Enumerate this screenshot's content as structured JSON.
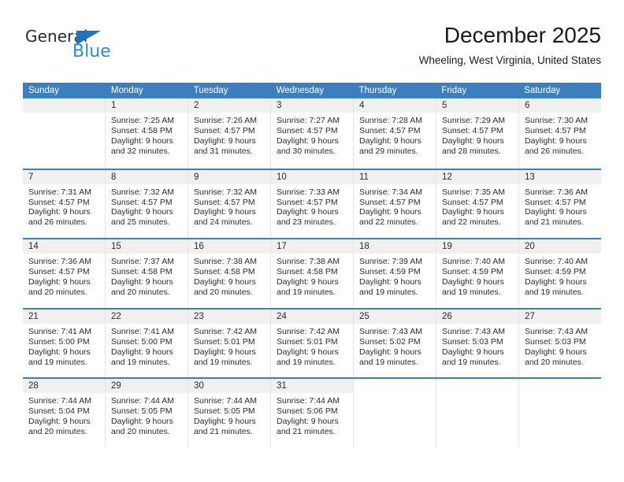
{
  "brand": {
    "name_top": "General",
    "name_bottom": "Blue",
    "triangle_color": "#1f72bd",
    "blue_color": "#2e8bd6"
  },
  "header": {
    "title": "December 2025",
    "subtitle": "Wheeling, West Virginia, United States",
    "accent_color": "#3d7ebf"
  },
  "weekdays": [
    "Sunday",
    "Monday",
    "Tuesday",
    "Wednesday",
    "Thursday",
    "Friday",
    "Saturday"
  ],
  "weeks": [
    [
      {
        "day": "",
        "sunrise": "",
        "sunset": "",
        "daylight1": "",
        "daylight2": "",
        "empty": true
      },
      {
        "day": "1",
        "sunrise": "Sunrise: 7:25 AM",
        "sunset": "Sunset: 4:58 PM",
        "daylight1": "Daylight: 9 hours",
        "daylight2": "and 32 minutes."
      },
      {
        "day": "2",
        "sunrise": "Sunrise: 7:26 AM",
        "sunset": "Sunset: 4:57 PM",
        "daylight1": "Daylight: 9 hours",
        "daylight2": "and 31 minutes."
      },
      {
        "day": "3",
        "sunrise": "Sunrise: 7:27 AM",
        "sunset": "Sunset: 4:57 PM",
        "daylight1": "Daylight: 9 hours",
        "daylight2": "and 30 minutes."
      },
      {
        "day": "4",
        "sunrise": "Sunrise: 7:28 AM",
        "sunset": "Sunset: 4:57 PM",
        "daylight1": "Daylight: 9 hours",
        "daylight2": "and 29 minutes."
      },
      {
        "day": "5",
        "sunrise": "Sunrise: 7:29 AM",
        "sunset": "Sunset: 4:57 PM",
        "daylight1": "Daylight: 9 hours",
        "daylight2": "and 28 minutes."
      },
      {
        "day": "6",
        "sunrise": "Sunrise: 7:30 AM",
        "sunset": "Sunset: 4:57 PM",
        "daylight1": "Daylight: 9 hours",
        "daylight2": "and 26 minutes."
      }
    ],
    [
      {
        "day": "7",
        "sunrise": "Sunrise: 7:31 AM",
        "sunset": "Sunset: 4:57 PM",
        "daylight1": "Daylight: 9 hours",
        "daylight2": "and 26 minutes."
      },
      {
        "day": "8",
        "sunrise": "Sunrise: 7:32 AM",
        "sunset": "Sunset: 4:57 PM",
        "daylight1": "Daylight: 9 hours",
        "daylight2": "and 25 minutes."
      },
      {
        "day": "9",
        "sunrise": "Sunrise: 7:32 AM",
        "sunset": "Sunset: 4:57 PM",
        "daylight1": "Daylight: 9 hours",
        "daylight2": "and 24 minutes."
      },
      {
        "day": "10",
        "sunrise": "Sunrise: 7:33 AM",
        "sunset": "Sunset: 4:57 PM",
        "daylight1": "Daylight: 9 hours",
        "daylight2": "and 23 minutes."
      },
      {
        "day": "11",
        "sunrise": "Sunrise: 7:34 AM",
        "sunset": "Sunset: 4:57 PM",
        "daylight1": "Daylight: 9 hours",
        "daylight2": "and 22 minutes."
      },
      {
        "day": "12",
        "sunrise": "Sunrise: 7:35 AM",
        "sunset": "Sunset: 4:57 PM",
        "daylight1": "Daylight: 9 hours",
        "daylight2": "and 22 minutes."
      },
      {
        "day": "13",
        "sunrise": "Sunrise: 7:36 AM",
        "sunset": "Sunset: 4:57 PM",
        "daylight1": "Daylight: 9 hours",
        "daylight2": "and 21 minutes."
      }
    ],
    [
      {
        "day": "14",
        "sunrise": "Sunrise: 7:36 AM",
        "sunset": "Sunset: 4:57 PM",
        "daylight1": "Daylight: 9 hours",
        "daylight2": "and 20 minutes."
      },
      {
        "day": "15",
        "sunrise": "Sunrise: 7:37 AM",
        "sunset": "Sunset: 4:58 PM",
        "daylight1": "Daylight: 9 hours",
        "daylight2": "and 20 minutes."
      },
      {
        "day": "16",
        "sunrise": "Sunrise: 7:38 AM",
        "sunset": "Sunset: 4:58 PM",
        "daylight1": "Daylight: 9 hours",
        "daylight2": "and 20 minutes."
      },
      {
        "day": "17",
        "sunrise": "Sunrise: 7:38 AM",
        "sunset": "Sunset: 4:58 PM",
        "daylight1": "Daylight: 9 hours",
        "daylight2": "and 19 minutes."
      },
      {
        "day": "18",
        "sunrise": "Sunrise: 7:39 AM",
        "sunset": "Sunset: 4:59 PM",
        "daylight1": "Daylight: 9 hours",
        "daylight2": "and 19 minutes."
      },
      {
        "day": "19",
        "sunrise": "Sunrise: 7:40 AM",
        "sunset": "Sunset: 4:59 PM",
        "daylight1": "Daylight: 9 hours",
        "daylight2": "and 19 minutes."
      },
      {
        "day": "20",
        "sunrise": "Sunrise: 7:40 AM",
        "sunset": "Sunset: 4:59 PM",
        "daylight1": "Daylight: 9 hours",
        "daylight2": "and 19 minutes."
      }
    ],
    [
      {
        "day": "21",
        "sunrise": "Sunrise: 7:41 AM",
        "sunset": "Sunset: 5:00 PM",
        "daylight1": "Daylight: 9 hours",
        "daylight2": "and 19 minutes."
      },
      {
        "day": "22",
        "sunrise": "Sunrise: 7:41 AM",
        "sunset": "Sunset: 5:00 PM",
        "daylight1": "Daylight: 9 hours",
        "daylight2": "and 19 minutes."
      },
      {
        "day": "23",
        "sunrise": "Sunrise: 7:42 AM",
        "sunset": "Sunset: 5:01 PM",
        "daylight1": "Daylight: 9 hours",
        "daylight2": "and 19 minutes."
      },
      {
        "day": "24",
        "sunrise": "Sunrise: 7:42 AM",
        "sunset": "Sunset: 5:01 PM",
        "daylight1": "Daylight: 9 hours",
        "daylight2": "and 19 minutes."
      },
      {
        "day": "25",
        "sunrise": "Sunrise: 7:43 AM",
        "sunset": "Sunset: 5:02 PM",
        "daylight1": "Daylight: 9 hours",
        "daylight2": "and 19 minutes."
      },
      {
        "day": "26",
        "sunrise": "Sunrise: 7:43 AM",
        "sunset": "Sunset: 5:03 PM",
        "daylight1": "Daylight: 9 hours",
        "daylight2": "and 19 minutes."
      },
      {
        "day": "27",
        "sunrise": "Sunrise: 7:43 AM",
        "sunset": "Sunset: 5:03 PM",
        "daylight1": "Daylight: 9 hours",
        "daylight2": "and 20 minutes."
      }
    ],
    [
      {
        "day": "28",
        "sunrise": "Sunrise: 7:44 AM",
        "sunset": "Sunset: 5:04 PM",
        "daylight1": "Daylight: 9 hours",
        "daylight2": "and 20 minutes."
      },
      {
        "day": "29",
        "sunrise": "Sunrise: 7:44 AM",
        "sunset": "Sunset: 5:05 PM",
        "daylight1": "Daylight: 9 hours",
        "daylight2": "and 20 minutes."
      },
      {
        "day": "30",
        "sunrise": "Sunrise: 7:44 AM",
        "sunset": "Sunset: 5:05 PM",
        "daylight1": "Daylight: 9 hours",
        "daylight2": "and 21 minutes."
      },
      {
        "day": "31",
        "sunrise": "Sunrise: 7:44 AM",
        "sunset": "Sunset: 5:06 PM",
        "daylight1": "Daylight: 9 hours",
        "daylight2": "and 21 minutes."
      },
      {
        "day": "",
        "sunrise": "",
        "sunset": "",
        "daylight1": "",
        "daylight2": "",
        "empty": true,
        "nohead": true
      },
      {
        "day": "",
        "sunrise": "",
        "sunset": "",
        "daylight1": "",
        "daylight2": "",
        "empty": true,
        "nohead": true
      },
      {
        "day": "",
        "sunrise": "",
        "sunset": "",
        "daylight1": "",
        "daylight2": "",
        "empty": true,
        "nohead": true
      }
    ]
  ]
}
